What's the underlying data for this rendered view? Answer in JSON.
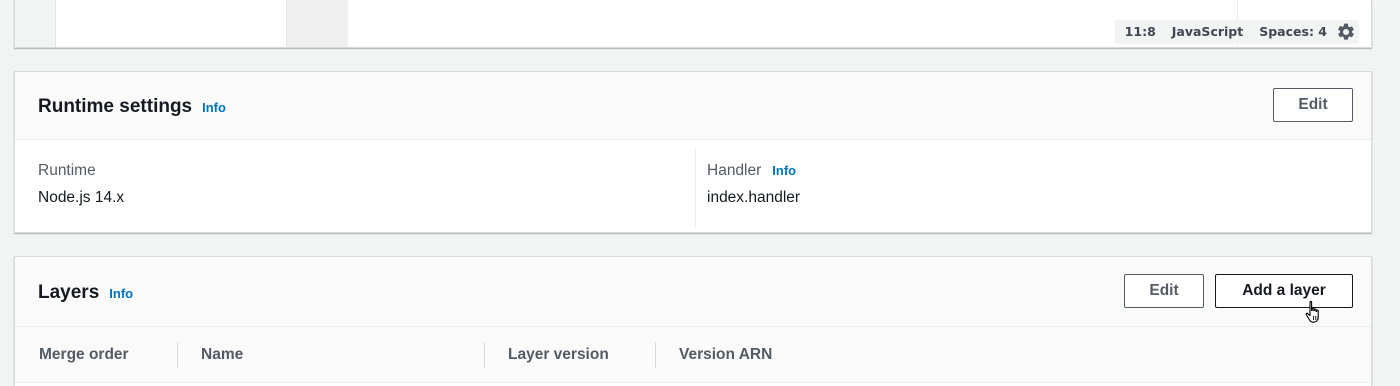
{
  "editor": {
    "status": {
      "cursor_position": "11:8",
      "language": "JavaScript",
      "spaces": "Spaces: 4",
      "settings_icon": "gear-icon"
    }
  },
  "runtime_settings": {
    "title": "Runtime settings",
    "info_label": "Info",
    "edit_label": "Edit",
    "fields": [
      {
        "key": "Runtime",
        "value": "Node.js 14.x"
      },
      {
        "key": "Handler",
        "value": "index.handler",
        "info_label": "Info"
      }
    ]
  },
  "layers": {
    "title": "Layers",
    "info_label": "Info",
    "edit_label": "Edit",
    "add_label": "Add a layer",
    "columns": [
      "Merge order",
      "Name",
      "Layer version",
      "Version ARN"
    ]
  },
  "colors": {
    "link": "#0073bb",
    "text": "#16191f",
    "muted": "#545b64",
    "background": "#f2f3f3"
  }
}
